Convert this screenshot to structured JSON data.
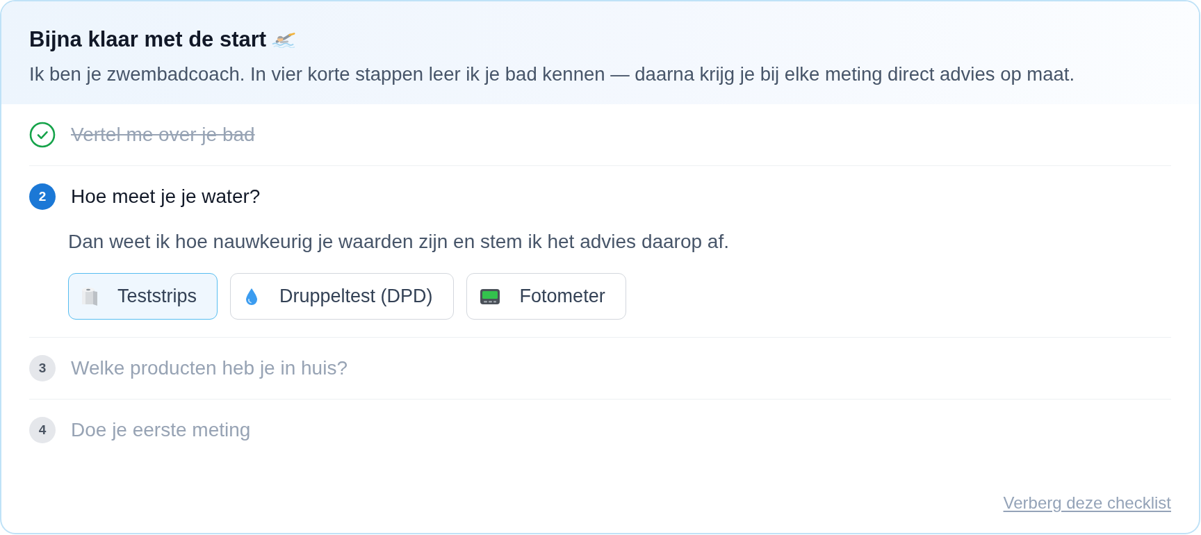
{
  "header": {
    "title": "Bijna klaar met de start",
    "subtitle": "Ik ben je zwembadcoach. In vier korte stappen leer ik je bad kennen — daarna krijg je bij elke meting direct advies op maat."
  },
  "steps": [
    {
      "completed": true,
      "active": false,
      "title": "Vertel me over je bad"
    },
    {
      "completed": false,
      "active": true,
      "number": "2",
      "title": "Hoe meet je je water?",
      "description": "Dan weet ik hoe nauwkeurig je waarden zijn en stem ik het advies daarop af.",
      "options": [
        {
          "label": "Teststrips",
          "selected": true
        },
        {
          "label": "Druppeltest (DPD)",
          "selected": false
        },
        {
          "label": "Fotometer",
          "selected": false
        }
      ]
    },
    {
      "completed": false,
      "active": false,
      "number": "3",
      "title": "Welke producten heb je in huis?"
    },
    {
      "completed": false,
      "active": false,
      "number": "4",
      "title": "Doe je eerste meting"
    }
  ],
  "footer": {
    "link": "Verberg deze checklist"
  }
}
